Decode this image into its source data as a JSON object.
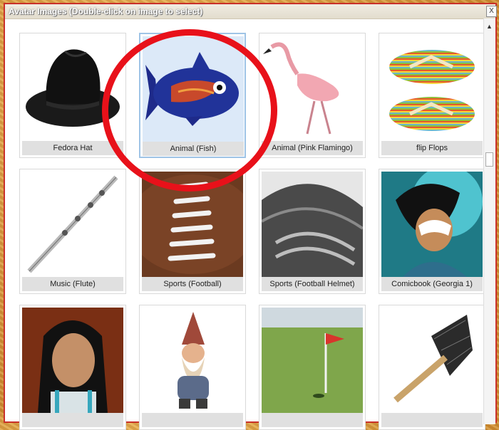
{
  "dialog": {
    "title": "Avatar Images (Double-click on image to select)",
    "close_label": "X"
  },
  "avatars": [
    {
      "caption": "Fedora Hat"
    },
    {
      "caption": "Animal (Fish)"
    },
    {
      "caption": "Animal (Pink Flamingo)"
    },
    {
      "caption": "flip Flops"
    },
    {
      "caption": "Music (Flute)"
    },
    {
      "caption": "Sports (Football)"
    },
    {
      "caption": "Sports (Football Helmet)"
    },
    {
      "caption": "Comicbook (Georgia 1)"
    },
    {
      "caption": ""
    },
    {
      "caption": ""
    },
    {
      "caption": ""
    },
    {
      "caption": ""
    }
  ],
  "selected_caption": "Animal (Fish)",
  "colors": {
    "highlight_ring": "#e8111a",
    "selected_border": "#9fc4e6"
  }
}
